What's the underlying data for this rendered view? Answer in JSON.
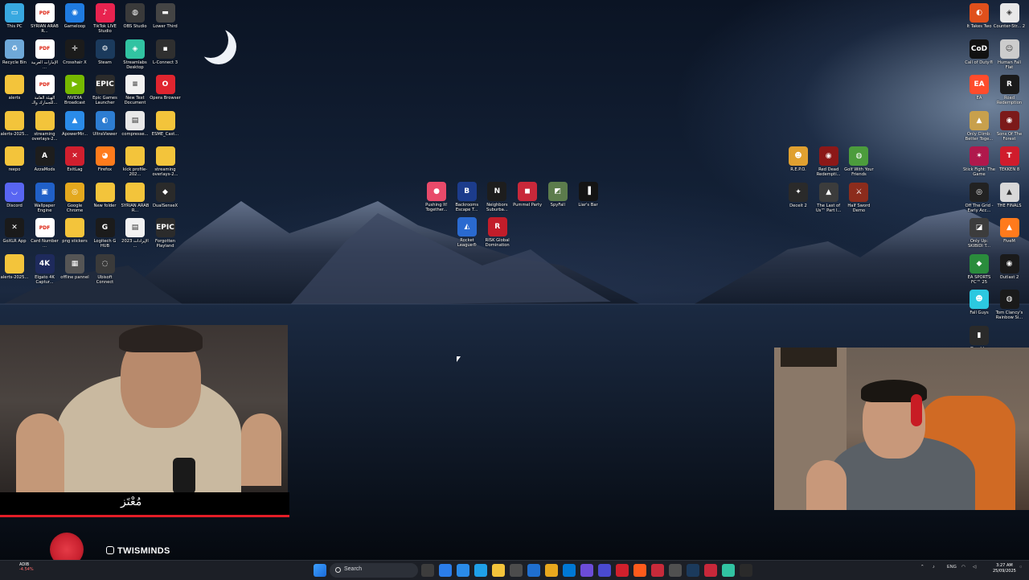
{
  "desktop_icons_left": [
    {
      "id": "this-pc",
      "label": "This PC",
      "glyph": "▭",
      "color": "#38a8e0"
    },
    {
      "id": "syrian-arab-1",
      "label": "SYRIAN ARAB R...",
      "glyph": "PDF",
      "color": "#ffffff"
    },
    {
      "id": "gameloop",
      "label": "Gameloop",
      "glyph": "◉",
      "color": "#1f7be0"
    },
    {
      "id": "tiktok-live",
      "label": "TikTok LIVE Studio",
      "glyph": "♪",
      "color": "#e8234f"
    },
    {
      "id": "obs",
      "label": "OBS Studio",
      "glyph": "◍",
      "color": "#3a3a3a"
    },
    {
      "id": "lower-third",
      "label": "Lower Third",
      "glyph": "▬",
      "color": "#444444"
    },
    {
      "id": "recycle-bin",
      "label": "Recycle Bin",
      "glyph": "♻",
      "color": "#6ea8d8"
    },
    {
      "id": "arabic-pdf-1",
      "label": "الإمارات العربية ...",
      "glyph": "PDF",
      "color": "#ffffff"
    },
    {
      "id": "crosshair-x",
      "label": "Crosshair X",
      "glyph": "✛",
      "color": "#1b1b1b"
    },
    {
      "id": "steam",
      "label": "Steam",
      "glyph": "⚙",
      "color": "#1b3a5c"
    },
    {
      "id": "streamlabs",
      "label": "Streamlabs Desktop",
      "glyph": "◈",
      "color": "#31c3a2"
    },
    {
      "id": "l-connect",
      "label": "L-Connect 3",
      "glyph": "▪",
      "color": "#2f2f2f"
    },
    {
      "id": "alerts",
      "label": "alerts",
      "glyph": "",
      "color": "#f3c43b"
    },
    {
      "id": "arabic-pdf-2",
      "label": "الهيئة العامة للجمارك والـ...",
      "glyph": "PDF",
      "color": "#ffffff"
    },
    {
      "id": "nvidia-broadcast",
      "label": "NVIDIA Broadcast",
      "glyph": "▶",
      "color": "#76b900"
    },
    {
      "id": "epic-games",
      "label": "Epic Games Launcher",
      "glyph": "EPIC",
      "color": "#2b2b2b"
    },
    {
      "id": "new-text-doc",
      "label": "New Text Document",
      "glyph": "≡",
      "color": "#f2f2f2"
    },
    {
      "id": "opera",
      "label": "Opera Browser",
      "glyph": "O",
      "color": "#e0252f"
    },
    {
      "id": "alerts-2025",
      "label": "alerts-2025...",
      "glyph": "",
      "color": "#f3c43b"
    },
    {
      "id": "streaming-overlays-1",
      "label": "streaming overlays-2...",
      "glyph": "",
      "color": "#f3c43b"
    },
    {
      "id": "apowermirror",
      "label": "ApowerMir...",
      "glyph": "▲",
      "color": "#2a8be8"
    },
    {
      "id": "ultraviewer",
      "label": "UltraViewer",
      "glyph": "◐",
      "color": "#2d7dd2"
    },
    {
      "id": "compress",
      "label": "compresse...",
      "glyph": "▤",
      "color": "#e8e8e8"
    },
    {
      "id": "esme-cast",
      "label": "ESME_Cast...",
      "glyph": "",
      "color": "#f3c43b"
    },
    {
      "id": "reepo",
      "label": "reepo",
      "glyph": "",
      "color": "#f3c43b"
    },
    {
      "id": "azzamods",
      "label": "AzzaMods",
      "glyph": "A",
      "color": "#1d1d1d"
    },
    {
      "id": "exitlag",
      "label": "ExitLag",
      "glyph": "✕",
      "color": "#d01f2e"
    },
    {
      "id": "firefox",
      "label": "Firefox",
      "glyph": "◕",
      "color": "#ff7b1c"
    },
    {
      "id": "kick-profile",
      "label": "kick profile-202...",
      "glyph": "",
      "color": "#f3c43b"
    },
    {
      "id": "streaming-overlays-2",
      "label": "streaming overlays-2...",
      "glyph": "",
      "color": "#f3c43b"
    },
    {
      "id": "discord",
      "label": "Discord",
      "glyph": "◡",
      "color": "#5865f2"
    },
    {
      "id": "wallpaper-engine",
      "label": "Wallpaper Engine",
      "glyph": "▣",
      "color": "#2060c8"
    },
    {
      "id": "chrome",
      "label": "Google Chrome",
      "glyph": "◎",
      "color": "#e3a81e"
    },
    {
      "id": "new-folder",
      "label": "New folder",
      "glyph": "",
      "color": "#f3c43b"
    },
    {
      "id": "syrian-arab-2",
      "label": "SYRIAN ARAB R...",
      "glyph": "",
      "color": "#f3c43b"
    },
    {
      "id": "dualsensex",
      "label": "DualSenseX",
      "glyph": "◆",
      "color": "#2a2a2a"
    },
    {
      "id": "goxlr",
      "label": "GoXLR App",
      "glyph": "✕",
      "color": "#1a1a1a"
    },
    {
      "id": "card-number",
      "label": "Card Number ...",
      "glyph": "PDF",
      "color": "#ffffff"
    },
    {
      "id": "png-stickers",
      "label": "png stickers",
      "glyph": "",
      "color": "#f3c43b"
    },
    {
      "id": "logitech-g-hub",
      "label": "Logitech G HUB",
      "glyph": "G",
      "color": "#1b1b1b"
    },
    {
      "id": "arabic-doc",
      "label": "الإيرادات 2023 ...",
      "glyph": "▤",
      "color": "#f2f2f2"
    },
    {
      "id": "forgotten-playland",
      "label": "Forgotten Playland",
      "glyph": "EPIC",
      "color": "#2b2b2b"
    },
    {
      "id": "alerts-2025-2",
      "label": "alerts-2025...",
      "glyph": "",
      "color": "#f3c43b"
    },
    {
      "id": "elgato",
      "label": "Elgato 4K Captur...",
      "glyph": "4K",
      "color": "#1e2a5c"
    },
    {
      "id": "offline-pannel",
      "label": "offline pannel",
      "glyph": "▦",
      "color": "#555555"
    },
    {
      "id": "ubisoft",
      "label": "Ubisoft Connect",
      "glyph": "◌",
      "color": "#3a3a3a"
    }
  ],
  "desktop_icons_center": [
    {
      "id": "pushing-it",
      "label": "Pushing It! Together...",
      "glyph": "●",
      "color": "#e84a6a"
    },
    {
      "id": "backrooms",
      "label": "Backrooms Escape T...",
      "glyph": "B",
      "color": "#1c3c8c"
    },
    {
      "id": "neighbors",
      "label": "Neighbors Suburba...",
      "glyph": "N",
      "color": "#1d1d1d"
    },
    {
      "id": "pummel-party",
      "label": "Pummel Party",
      "glyph": "◼",
      "color": "#c8283a"
    },
    {
      "id": "spyfall",
      "label": "SpyFall",
      "glyph": "◩",
      "color": "#5c7c4c"
    },
    {
      "id": "liars-bar",
      "label": "Liar's Bar",
      "glyph": "▐",
      "color": "#141414"
    },
    {
      "id": "rocket-league",
      "label": "Rocket League®",
      "glyph": "◭",
      "color": "#2a6ad0"
    },
    {
      "id": "risk",
      "label": "RISK Global Domination",
      "glyph": "R",
      "color": "#c21d2a"
    }
  ],
  "desktop_icons_right_group": [
    {
      "id": "repo",
      "label": "R.E.P.O.",
      "glyph": "☻",
      "color": "#e0a030"
    },
    {
      "id": "rdr",
      "label": "Red Dead Redempti...",
      "glyph": "◉",
      "color": "#8c1818"
    },
    {
      "id": "golf-friends",
      "label": "Golf With Your Friends",
      "glyph": "◍",
      "color": "#4c9c3c"
    },
    {
      "id": "deceit2",
      "label": "Deceit 2",
      "glyph": "✦",
      "color": "#2a2a2a"
    },
    {
      "id": "tlou",
      "label": "The Last of Us™ Part I...",
      "glyph": "▲",
      "color": "#3c3c3c"
    },
    {
      "id": "half-sword",
      "label": "Half Sword Demo",
      "glyph": "⚔",
      "color": "#8c2c1c"
    }
  ],
  "desktop_icons_right": [
    {
      "id": "it-takes-two",
      "label": "It Takes Two",
      "glyph": "◐",
      "color": "#e0501c"
    },
    {
      "id": "cs2",
      "label": "Counter-Str... 2",
      "glyph": "◈",
      "color": "#e8e8e8"
    },
    {
      "id": "cod",
      "label": "Call of Duty®",
      "glyph": "CoD",
      "color": "#111111"
    },
    {
      "id": "human-fall-flat",
      "label": "Human Fall Flat",
      "glyph": "☺",
      "color": "#cccccc"
    },
    {
      "id": "ea",
      "label": "EA",
      "glyph": "EA",
      "color": "#ff4c2c"
    },
    {
      "id": "road-redemption",
      "label": "Road Redemption",
      "glyph": "R",
      "color": "#1a1a1a"
    },
    {
      "id": "only-climb",
      "label": "Only Climb: Better Toge...",
      "glyph": "▲",
      "color": "#c8a04c"
    },
    {
      "id": "sons-of-forest",
      "label": "Sons Of The Forest",
      "glyph": "◉",
      "color": "#7c1a1a"
    },
    {
      "id": "stick-fight",
      "label": "Stick Fight: The Game",
      "glyph": "✶",
      "color": "#b0184c"
    },
    {
      "id": "tekken8",
      "label": "TEKKEN 8",
      "glyph": "T",
      "color": "#d01c2c"
    },
    {
      "id": "off-the-grid",
      "label": "Off The Grid - Early Acc...",
      "glyph": "◎",
      "color": "#222222"
    },
    {
      "id": "the-finals",
      "label": "THE FINALS",
      "glyph": "▲",
      "color": "#d8d8d8"
    },
    {
      "id": "only-up",
      "label": "Only Up: SKIBIDI T...",
      "glyph": "◪",
      "color": "#3c3c3c"
    },
    {
      "id": "fivem",
      "label": "FiveM",
      "glyph": "▲",
      "color": "#ff7a1c"
    },
    {
      "id": "ea-fc",
      "label": "EA SPORTS FC™ 25",
      "glyph": "◆",
      "color": "#2a8c3c"
    },
    {
      "id": "outlast2",
      "label": "Outlast 2",
      "glyph": "◉",
      "color": "#1a1a1a"
    },
    {
      "id": "fall-guys",
      "label": "Fall Guys",
      "glyph": "☻",
      "color": "#2cc8e0"
    },
    {
      "id": "rainbow6",
      "label": "Tom Clancy's Rainbow Si...",
      "glyph": "◍",
      "color": "#1a1a1a"
    },
    {
      "id": "dead-by-daylight",
      "label": "Dead by",
      "glyph": "▮",
      "color": "#2a2a2a"
    }
  ],
  "overlay": {
    "name_signature": "مُعْتَز",
    "instagram_handle": "TWISMINDS"
  },
  "taskbar": {
    "stock_name": "ADIB",
    "stock_change": "-4.54%",
    "search_placeholder": "Search",
    "language": "ENG",
    "time": "3:27 AM",
    "date": "25/09/2025",
    "app_colors": [
      "#3c3c3c",
      "#2b7de9",
      "#2a8be8",
      "#1fa0e8",
      "#f3c43b",
      "#4c4c4c",
      "#1f6fd0",
      "#e8a81e",
      "#0078d4",
      "#6c4cd8",
      "#4a4ad0",
      "#d0202c",
      "#ff5b1c",
      "#c82a3a",
      "#505050",
      "#1b3a5c",
      "#c8283a",
      "#31c3a2",
      "#2a2a2a"
    ]
  }
}
